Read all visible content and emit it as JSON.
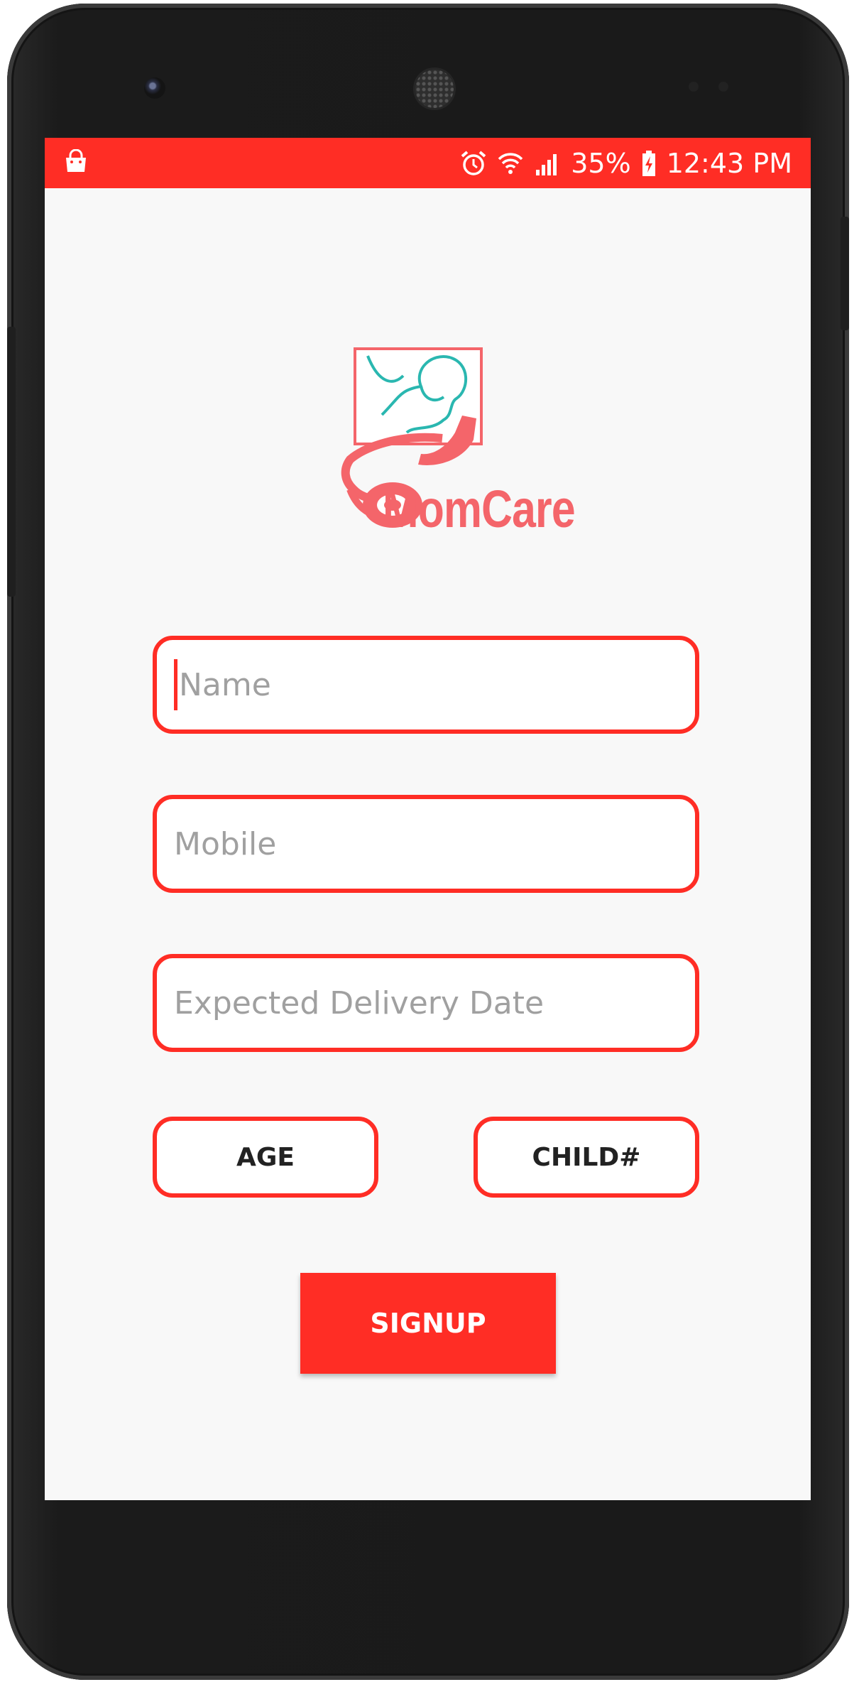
{
  "status_bar": {
    "battery": "35%",
    "time": "12:43 PM",
    "icons": [
      "shopping-bag-icon",
      "alarm-icon",
      "wifi-icon",
      "signal-icon",
      "battery-charging-icon"
    ]
  },
  "logo": {
    "text": "MomCare"
  },
  "form": {
    "name_placeholder": "Name",
    "mobile_placeholder": "Mobile",
    "edd_placeholder": "Expected Delivery Date",
    "age_label": "AGE",
    "child_label": "CHILD#",
    "signup_label": "SIGNUP"
  },
  "colors": {
    "accent": "#ff2d25",
    "logo": "#f4656a",
    "logo_teal": "#2ab7b0",
    "background": "#f8f8f8",
    "placeholder": "#a0a0a0"
  }
}
